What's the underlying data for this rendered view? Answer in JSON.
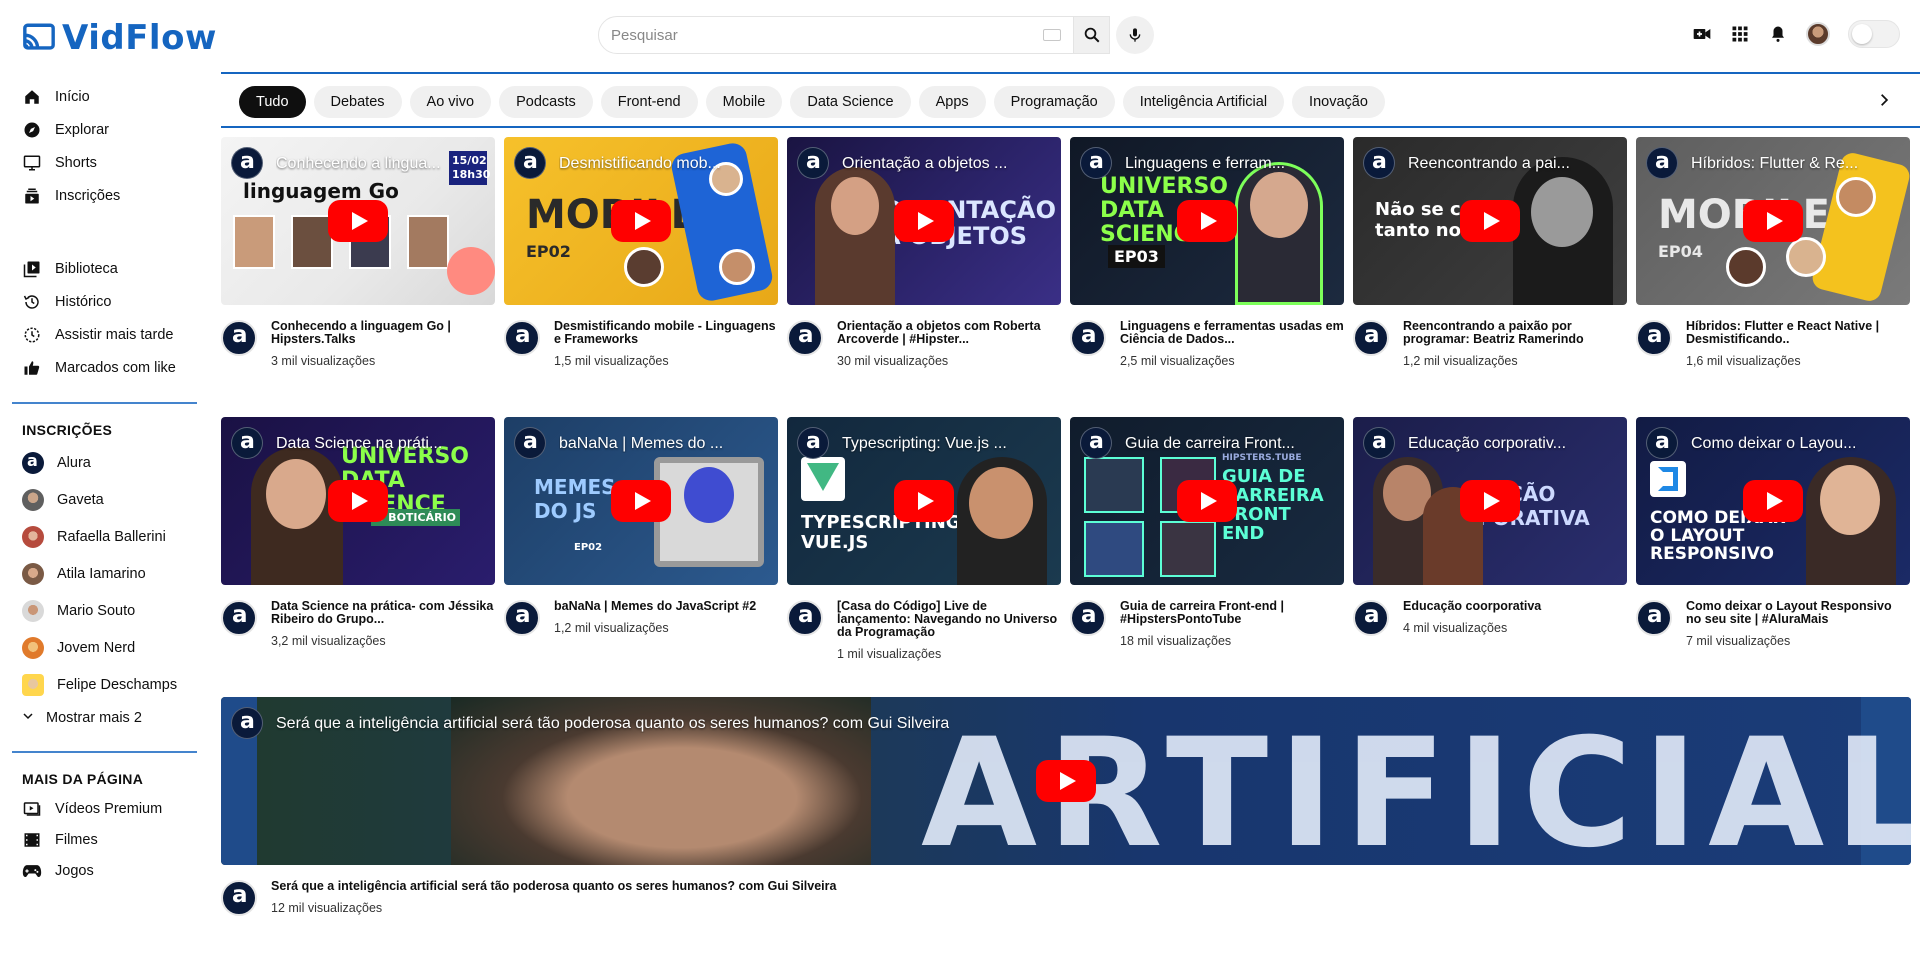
{
  "app": {
    "name": "VidFlow"
  },
  "search": {
    "placeholder": "Pesquisar"
  },
  "sidebar": {
    "main": [
      {
        "label": "Início",
        "icon": "home-icon"
      },
      {
        "label": "Explorar",
        "icon": "compass-icon"
      },
      {
        "label": "Shorts",
        "icon": "shorts-icon"
      },
      {
        "label": "Inscrições",
        "icon": "subscriptions-icon"
      }
    ],
    "library": [
      {
        "label": "Biblioteca",
        "icon": "library-icon"
      },
      {
        "label": "Histórico",
        "icon": "history-icon"
      },
      {
        "label": "Assistir mais tarde",
        "icon": "clock-icon"
      },
      {
        "label": "Marcados com like",
        "icon": "thumbs-up-icon"
      }
    ],
    "subscriptions_title": "INSCRIÇÕES",
    "subscriptions": [
      {
        "label": "Alura"
      },
      {
        "label": "Gaveta"
      },
      {
        "label": "Rafaella Ballerini"
      },
      {
        "label": "Atila Iamarino"
      },
      {
        "label": "Mario Souto"
      },
      {
        "label": "Jovem Nerd"
      },
      {
        "label": "Felipe Deschamps"
      }
    ],
    "show_more": "Mostrar mais 2",
    "more_title": "MAIS DA PÁGINA",
    "more": [
      {
        "label": "Vídeos Premium",
        "icon": "premium-icon"
      },
      {
        "label": "Filmes",
        "icon": "film-icon"
      },
      {
        "label": "Jogos",
        "icon": "gamepad-icon"
      }
    ]
  },
  "chips": [
    "Tudo",
    "Debates",
    "Ao vivo",
    "Podcasts",
    "Front-end",
    "Mobile",
    "Data Science",
    "Apps",
    "Programação",
    "Inteligência Artificial",
    "Inovação"
  ],
  "videos_row1": [
    {
      "thumb_title": "Conhecendo a lingua...",
      "title": "Conhecendo a linguagem Go | Hipsters.Talks",
      "views": "3 mil visualizações",
      "art": "linguagem Go",
      "art2": "15/02 18h30"
    },
    {
      "thumb_title": "Desmistificando mob...",
      "title": "Desmistificando mobile - Linguagens e Frameworks",
      "views": "1,5 mil visualizações",
      "art": "MOBILE",
      "art2": "EP02"
    },
    {
      "thumb_title": "Orientação a objetos ...",
      "title": "Orientação a objetos com Roberta Arcoverde | #Hipster...",
      "views": "30 mil visualizações",
      "art": "ORIENTAÇÃO A OBJETOS",
      "art2": ""
    },
    {
      "thumb_title": "Linguagens e ferram...",
      "title": "Linguagens e ferramentas usadas em Ciência de Dados...",
      "views": "2,5 mil visualizações",
      "art": "UNIVERSO DATA SCIENCE",
      "art2": "EP03"
    },
    {
      "thumb_title": "Reencontrando a pai...",
      "title": "Reencontrando a paixão por programar: Beatriz Ramerindo",
      "views": "1,2 mil visualizações",
      "art": "Não se co tanto no i",
      "art2": ""
    },
    {
      "thumb_title": "Híbridos: Flutter & Re...",
      "title": "Híbridos: Flutter e React Native | Desmistificando..",
      "views": "1,6 mil visualizações",
      "art": "MOBILE",
      "art2": "EP04"
    }
  ],
  "videos_row2": [
    {
      "thumb_title": "Data Science na práti...",
      "title": "Data Science na prática- com Jéssika Ribeiro do Grupo...",
      "views": "3,2 mil visualizações",
      "art": "UNIVERSO DATA SCIENCE",
      "art2": "O BOTICÁRIO"
    },
    {
      "thumb_title": "baNaNa | Memes do ...",
      "title": "baNaNa | Memes do JavaScript #2",
      "views": "1,2 mil visualizações",
      "art": "MEMES DO JS",
      "art2": "EP02"
    },
    {
      "thumb_title": "Typescripting: Vue.js ...",
      "title": "[Casa do Código] Live de lançamento: Navegando no Universo da Programação",
      "views": "1 mil visualizações",
      "art": "TYPESCRIPTING: VUE.JS",
      "art2": ""
    },
    {
      "thumb_title": "Guia de carreira Front...",
      "title": "Guia de carreira Front-end | #HipstersPontoTube",
      "views": "18 mil visualizações",
      "art": "GUIA DE CARREIRA FRONT END",
      "art2": "HIPSTERS.TUBE"
    },
    {
      "thumb_title": "Educação corporativ...",
      "title": "Educação coorporativa",
      "views": "4 mil visualizações",
      "art": "CAÇÃO PORATIVA",
      "art2": ""
    },
    {
      "thumb_title": "Como deixar o Layou...",
      "title": "Como deixar o Layout Responsivo no seu site | #AluraMais",
      "views": "7 mil visualizações",
      "art": "COMO DEIXAR O LAYOUT RESPONSIVO",
      "art2": ""
    }
  ],
  "featured": {
    "thumb_title": "Será que a inteligência artificial será tão poderosa quanto os seres humanos? com Gui Silveira",
    "title": "Será que a inteligência artificial será tão poderosa quanto os seres humanos? com Gui Silveira",
    "views": "12 mil visualizações",
    "art": "ARTIFICIAL"
  },
  "colors": {
    "brand": "#1565c0",
    "play": "#ff0000",
    "chip_active": "#0f0f0f"
  }
}
